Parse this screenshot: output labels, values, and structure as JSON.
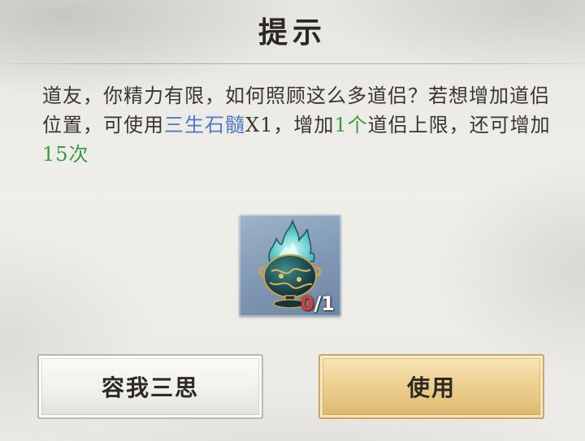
{
  "dialog": {
    "title": "提示",
    "message": {
      "part1": "道友，你精力有限，如何照顾这么多道侣？若想增加道侣位置，可使用",
      "item_name": "三生石髓",
      "part2": "X1，增加",
      "add_count": "1个",
      "part3": "道侣上限，还可增加",
      "remaining": "15次"
    },
    "item": {
      "icon": "incense-burner-icon",
      "have": "0",
      "need": "/1"
    },
    "buttons": {
      "cancel_label": "容我三思",
      "confirm_label": "使用"
    }
  },
  "colors": {
    "highlight_blue": "#4f79c7",
    "highlight_green": "#3f9a3f",
    "count_red": "#e23a3a",
    "confirm_gold": "#e6c47e"
  }
}
